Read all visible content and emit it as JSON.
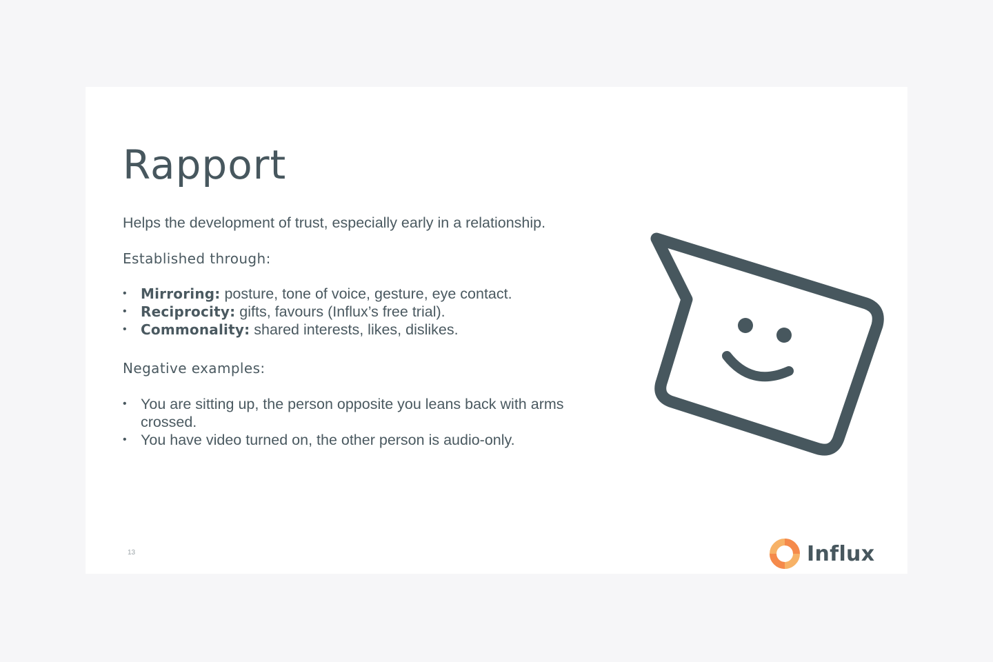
{
  "slide": {
    "title": "Rapport",
    "intro": "Helps the development of trust, especially early in a relationship.",
    "established_heading": "Established through:",
    "established_items": [
      {
        "term": "Mirroring:",
        "text": " posture, tone of voice, gesture, eye contact."
      },
      {
        "term": "Reciprocity:",
        "text": " gifts, favours (Influx’s free trial)."
      },
      {
        "term": "Commonality:",
        "text": " shared interests, likes, dislikes."
      }
    ],
    "negative_heading": "Negative examples:",
    "negative_items": [
      "You are sitting up, the person opposite you leans back with arms crossed.",
      "You have video turned on, the other person is audio-only."
    ],
    "page_number": "13",
    "logo_text": "Influx",
    "illustration_icon": "smiling-speech-bubble-icon"
  },
  "colors": {
    "text": "#4a5960",
    "title": "#47575e",
    "icon_stroke": "#47575e",
    "logo_orange": "#f58a4b",
    "logo_light_orange": "#f7b267",
    "background": "#f6f6f8",
    "slide": "#ffffff"
  }
}
